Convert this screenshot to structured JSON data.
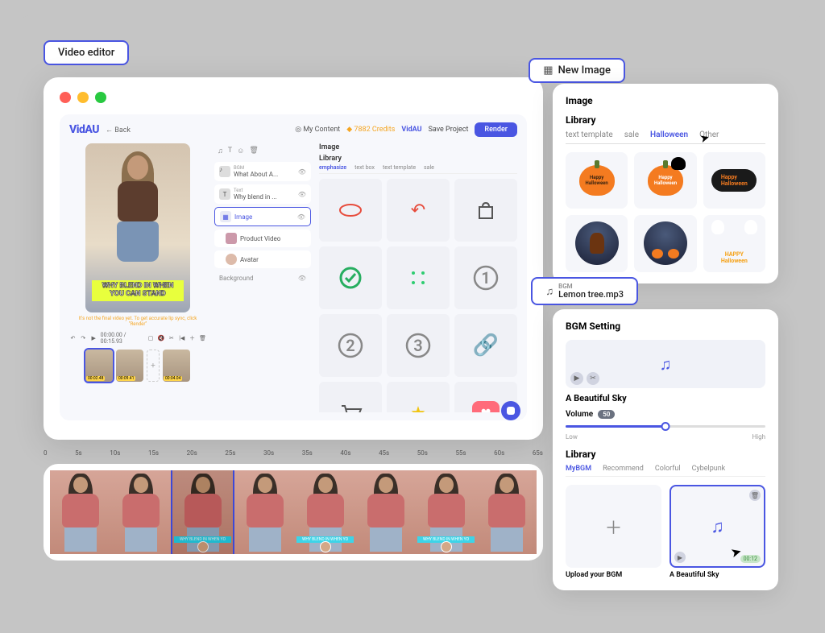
{
  "labels": {
    "video_editor": "Video editor",
    "new_image": "New Image",
    "bgm_label_title": "BGM",
    "bgm_label_file": "Lemon tree.mp3"
  },
  "app": {
    "logo": "VidAU",
    "back": "Back",
    "my_content": "My Content",
    "credits": "7882 Credits",
    "brand_small": "VidAU",
    "save": "Save Project",
    "render": "Render"
  },
  "preview": {
    "caption": "WHY BLEND IN WHEN YOU CAN STAND",
    "hint": "It's not the final video yet. To get accurate lip sync, click \"Render\""
  },
  "playbar": {
    "time_current": "00:00.00",
    "time_total": "00:15.93"
  },
  "clips": [
    {
      "dur": "00:02.48"
    },
    {
      "dur": "00:09.41"
    },
    {
      "dur": "00:04.04"
    }
  ],
  "layers": {
    "section1": {
      "title": "BGM",
      "subtitle": "What About A..."
    },
    "section2": {
      "title": "Text",
      "subtitle": "Why blend in ..."
    },
    "image": "Image",
    "product": "Product Video",
    "avatar": "Avatar",
    "background": "Background"
  },
  "library": {
    "title": "Image",
    "subtitle": "Library",
    "tabs": [
      "emphasize",
      "text box",
      "text template",
      "sale"
    ]
  },
  "ruler": [
    "0",
    "5s",
    "10s",
    "15s",
    "20s",
    "25s",
    "30s",
    "35s",
    "40s",
    "45s",
    "50s",
    "55s",
    "60s",
    "65s"
  ],
  "image_panel": {
    "h1": "Image",
    "h2": "Library",
    "tabs": [
      "text template",
      "sale",
      "Halloween",
      "Other"
    ]
  },
  "bgm_panel": {
    "title": "BGM Setting",
    "track": "A Beautiful Sky",
    "volume_label": "Volume",
    "volume_value": "50",
    "low": "Low",
    "high": "High",
    "lib": "Library",
    "tabs": [
      "MyBGM",
      "Recommend",
      "Colorful",
      "Cybelpunk"
    ],
    "upload": "Upload your BGM",
    "item2": "A Beautiful Sky",
    "item2_dur": "00:12"
  }
}
